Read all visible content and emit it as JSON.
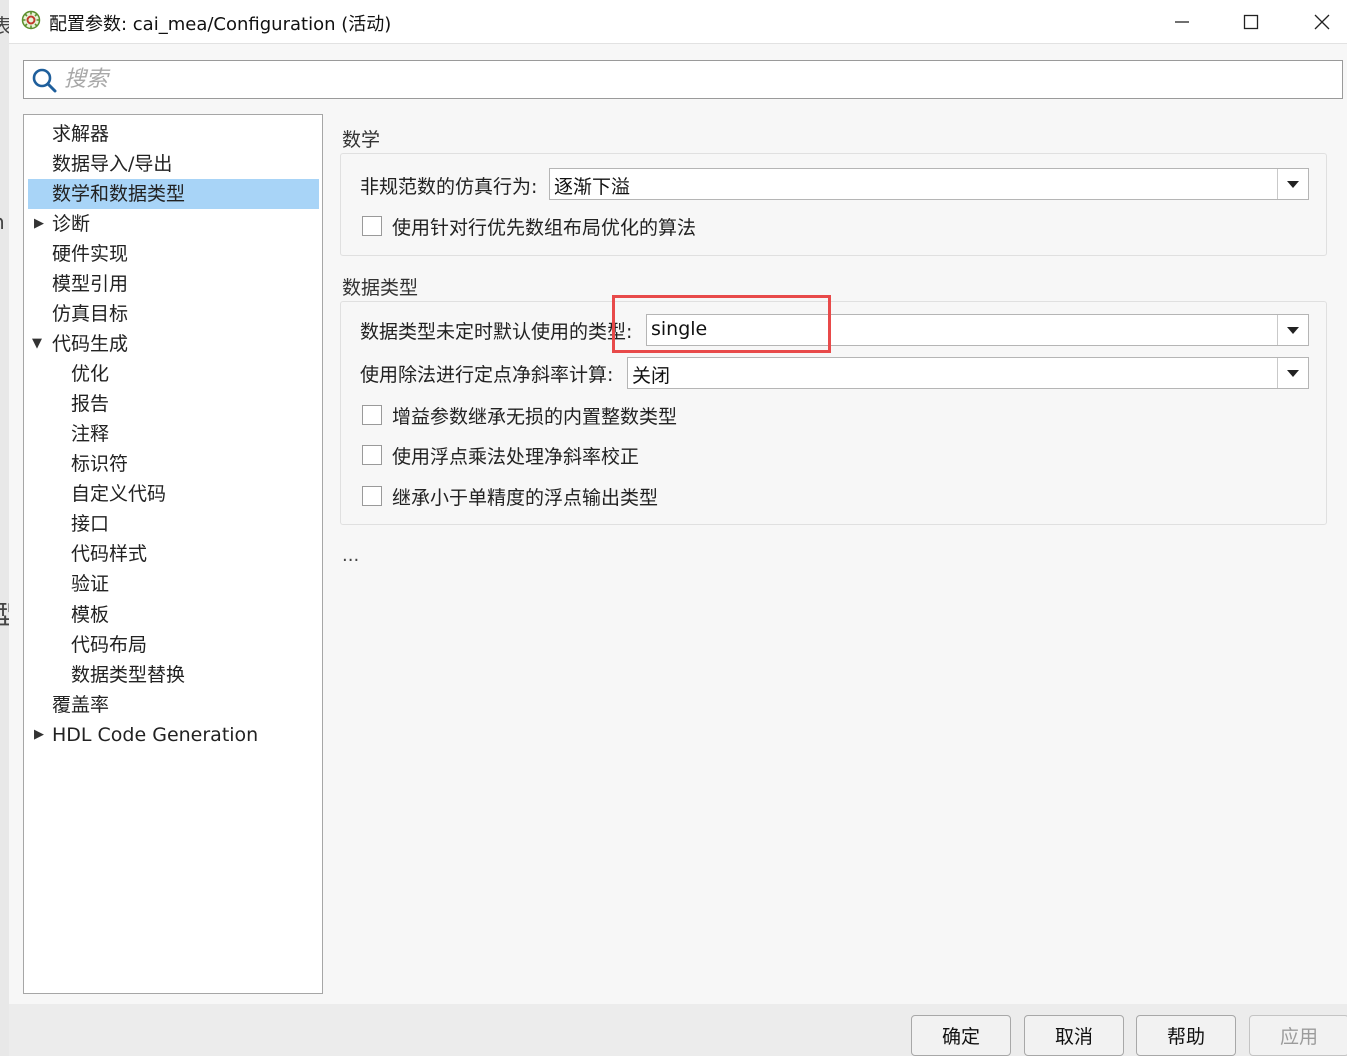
{
  "window": {
    "title": "配置参数: cai_mea/Configuration (活动)",
    "minimize_glyph": "—",
    "maximize_glyph": "☐",
    "close_glyph": "✕",
    "icon": "simulink-config-gear-icon"
  },
  "background": {
    "glyph_top": "表",
    "glyph_mid": "h",
    "glyph_bottom": "型"
  },
  "search": {
    "placeholder": "搜索"
  },
  "tree": {
    "items": [
      {
        "label": "求解器",
        "level": 0,
        "expander": ""
      },
      {
        "label": "数据导入/导出",
        "level": 0,
        "expander": ""
      },
      {
        "label": "数学和数据类型",
        "level": 0,
        "expander": "",
        "selected": true
      },
      {
        "label": "诊断",
        "level": 0,
        "expander": "collapsed"
      },
      {
        "label": "硬件实现",
        "level": 0,
        "expander": ""
      },
      {
        "label": "模型引用",
        "level": 0,
        "expander": ""
      },
      {
        "label": "仿真目标",
        "level": 0,
        "expander": ""
      },
      {
        "label": "代码生成",
        "level": 0,
        "expander": "expanded"
      },
      {
        "label": "优化",
        "level": 1,
        "expander": ""
      },
      {
        "label": "报告",
        "level": 1,
        "expander": ""
      },
      {
        "label": "注释",
        "level": 1,
        "expander": ""
      },
      {
        "label": "标识符",
        "level": 1,
        "expander": ""
      },
      {
        "label": "自定义代码",
        "level": 1,
        "expander": ""
      },
      {
        "label": "接口",
        "level": 1,
        "expander": ""
      },
      {
        "label": "代码样式",
        "level": 1,
        "expander": ""
      },
      {
        "label": "验证",
        "level": 1,
        "expander": ""
      },
      {
        "label": "模板",
        "level": 1,
        "expander": ""
      },
      {
        "label": "代码布局",
        "level": 1,
        "expander": ""
      },
      {
        "label": "数据类型替换",
        "level": 1,
        "expander": ""
      },
      {
        "label": "覆盖率",
        "level": 0,
        "expander": ""
      },
      {
        "label": "HDL Code Generation",
        "level": 0,
        "expander": "collapsed"
      }
    ]
  },
  "math": {
    "section_title": "数学",
    "denormal_label": "非规范数的仿真行为:",
    "denormal_value": "逐渐下溢",
    "row_major_label": "使用针对行优先数组布局优化的算法"
  },
  "datatypes": {
    "section_title": "数据类型",
    "default_type_label": "数据类型未定时默认使用的类型:",
    "default_type_value": "single",
    "division_label": "使用除法进行定点净斜率计算:",
    "division_value": "关闭",
    "cb1_label": "增益参数继承无损的内置整数类型",
    "cb2_label": "使用浮点乘法处理净斜率校正",
    "cb3_label": "继承小于单精度的浮点输出类型"
  },
  "ellipsis": "...",
  "footer": {
    "ok": "确定",
    "cancel": "取消",
    "help": "帮助",
    "apply": "应用"
  },
  "colors": {
    "selection": "#a8d4f7",
    "highlight_box": "#e84a4a"
  }
}
